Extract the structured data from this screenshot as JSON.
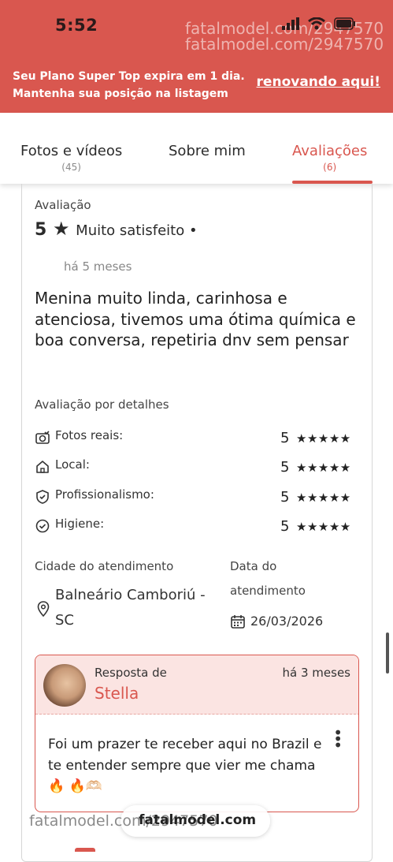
{
  "status_bar": {
    "time": "5:52",
    "watermark_line1": "fatalmodel.com/2947570",
    "watermark_line2": "fatalmodel.com/2947570",
    "icons": [
      "signal-icon",
      "wifi-icon",
      "battery-icon"
    ]
  },
  "banner": {
    "line1": "Seu Plano Super Top expira em 1 dia.",
    "line2": "Mantenha sua posição na listagem",
    "link": "renovando aqui!"
  },
  "tabs": [
    {
      "label": "Fotos e vídeos",
      "count": "(45)"
    },
    {
      "label": "Sobre mim",
      "count": ""
    },
    {
      "label": "Avaliações",
      "count": "(6)",
      "active": true
    }
  ],
  "review": {
    "section_label": "Avaliação",
    "score": "5",
    "star": "★",
    "verdict": "Muito satisfeito •",
    "time": "há 5 meses",
    "text": "Menina muito linda, carinhosa e atenciosa, tivemos uma ótima química e boa conversa, repetiria dnv sem pensar",
    "details_label": "Avaliação por detalhes",
    "details": [
      {
        "icon": "camera-check-icon",
        "label": "Fotos reais:",
        "score": "5",
        "stars": "★★★★★"
      },
      {
        "icon": "home-icon",
        "label": "Local:",
        "score": "5",
        "stars": "★★★★★"
      },
      {
        "icon": "shield-check-icon",
        "label": "Profissionalismo:",
        "score": "5",
        "stars": "★★★★★"
      },
      {
        "icon": "check-circle-icon",
        "label": "Higiene:",
        "score": "5",
        "stars": "★★★★★"
      }
    ],
    "city_label": "Cidade do atendimento",
    "city_line1": "Balneário Camboriú -",
    "city_line2": "SC",
    "date_label_line1": "Data do",
    "date_label_line2": "atendimento",
    "date": "26/03/2026"
  },
  "response": {
    "by_label": "Resposta de",
    "name": "Stella",
    "time": "há 3 meses",
    "text": "Foi um prazer te receber aqui no Brazil e te entender sempre que vier me chama 🔥 🔥🫶🏻"
  },
  "bottom": {
    "watermark": "fatalmodel.com/2947570",
    "pill_text": "fatalmodel.com"
  },
  "colors": {
    "accent": "#d9574f",
    "response_header_bg": "#fbe4e2"
  }
}
